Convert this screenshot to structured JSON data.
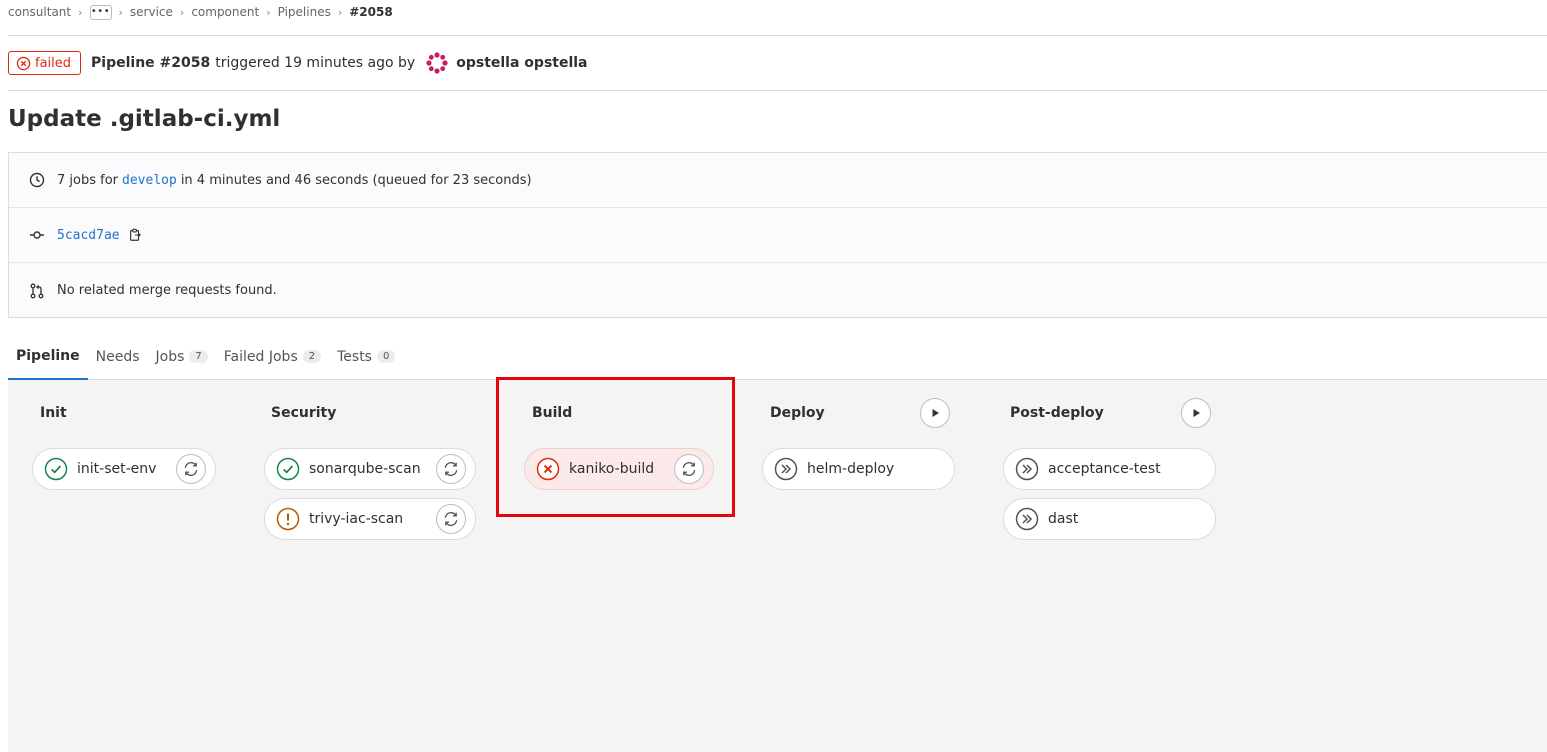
{
  "breadcrumb": {
    "items": [
      "consultant",
      "service",
      "component",
      "Pipelines"
    ],
    "more": "•••",
    "current": "#2058"
  },
  "header": {
    "status": "failed",
    "pipeline_title": "Pipeline #2058",
    "triggered_text": "triggered 19 minutes ago by",
    "author": "opstella opstella"
  },
  "commit_title": "Update .gitlab-ci.yml",
  "info": {
    "jobs_prefix": "7 jobs for",
    "branch": "develop",
    "jobs_suffix": "in 4 minutes and 46 seconds (queued for 23 seconds)",
    "commit_sha": "5cacd7ae",
    "merge_requests": "No related merge requests found."
  },
  "tabs": [
    {
      "label": "Pipeline",
      "count": null
    },
    {
      "label": "Needs",
      "count": null
    },
    {
      "label": "Jobs",
      "count": "7"
    },
    {
      "label": "Failed Jobs",
      "count": "2"
    },
    {
      "label": "Tests",
      "count": "0"
    }
  ],
  "stages": [
    {
      "name": "Init",
      "jobs": [
        {
          "name": "init-set-env",
          "status": "success"
        }
      ]
    },
    {
      "name": "Security",
      "jobs": [
        {
          "name": "sonarqube-scan",
          "status": "success"
        },
        {
          "name": "trivy-iac-scan",
          "status": "warning"
        }
      ]
    },
    {
      "name": "Build",
      "jobs": [
        {
          "name": "kaniko-build",
          "status": "failed"
        }
      ]
    },
    {
      "name": "Deploy",
      "jobs": [
        {
          "name": "helm-deploy",
          "status": "skipped"
        }
      ]
    },
    {
      "name": "Post-deploy",
      "jobs": [
        {
          "name": "acceptance-test",
          "status": "skipped"
        },
        {
          "name": "dast",
          "status": "skipped"
        }
      ]
    }
  ],
  "colors": {
    "success": "#108548",
    "warning": "#ab6100",
    "failed": "#dd2b0e",
    "skipped": "#535158",
    "link": "#1f75cb",
    "highlight": "#e3060a"
  }
}
